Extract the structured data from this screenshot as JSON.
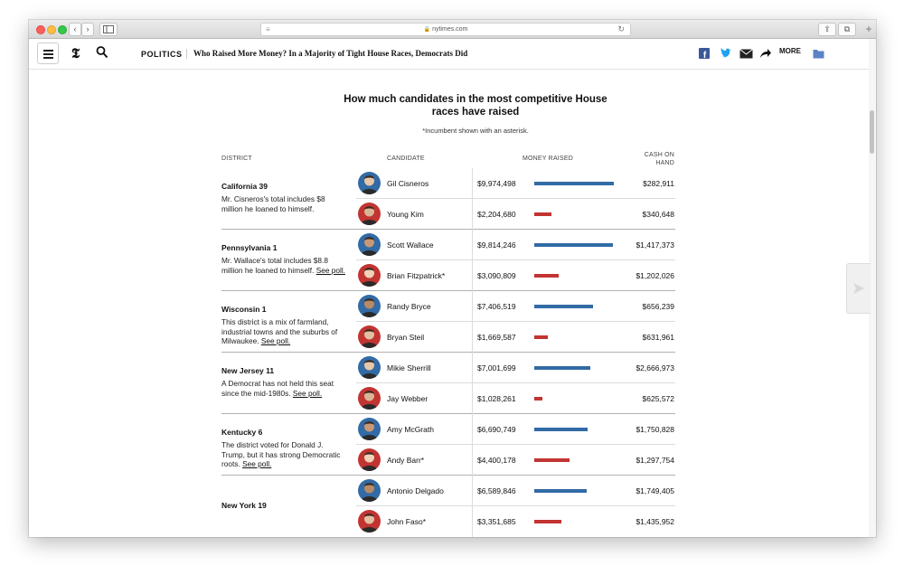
{
  "browser": {
    "url": "nytimes.com",
    "plus": "+"
  },
  "nav": {
    "section": "POLITICS",
    "headline": "Who Raised More Money? In a Majority of Tight House Races, Democrats Did",
    "more": "MORE"
  },
  "graphic": {
    "title": "How much candidates in the most competitive House races have raised",
    "note": "*Incumbent shown with an asterisk.",
    "columns": {
      "district": "DISTRICT",
      "candidate": "CANDIDATE",
      "money": "MONEY RAISED",
      "cash": "CASH ON HAND"
    },
    "max_money": 9974498,
    "colors": {
      "dem": "#326ba5",
      "rep": "#c23432"
    },
    "races": [
      {
        "district": "California 39",
        "desc": "Mr. Cisneros's total includes $8 million he loaned to himself.",
        "link": "",
        "candidates": [
          {
            "name": "Gil Cisneros",
            "money": "$9,974,498",
            "amount": 9974498,
            "cash": "$282,911",
            "party": "dem"
          },
          {
            "name": "Young Kim",
            "money": "$2,204,680",
            "amount": 2204680,
            "cash": "$340,648",
            "party": "rep"
          }
        ]
      },
      {
        "district": "Pennsylvania 1",
        "desc": "Mr. Wallace's total includes $8.8 million he loaned to himself. ",
        "link": "See poll.",
        "candidates": [
          {
            "name": "Scott Wallace",
            "money": "$9,814,246",
            "amount": 9814246,
            "cash": "$1,417,373",
            "party": "dem"
          },
          {
            "name": "Brian Fitzpatrick*",
            "money": "$3,090,809",
            "amount": 3090809,
            "cash": "$1,202,026",
            "party": "rep"
          }
        ]
      },
      {
        "district": "Wisconsin 1",
        "desc": "This district is a mix of farmland, industrial towns and the suburbs of Milwaukee. ",
        "link": "See poll.",
        "candidates": [
          {
            "name": "Randy Bryce",
            "money": "$7,406,519",
            "amount": 7406519,
            "cash": "$656,239",
            "party": "dem"
          },
          {
            "name": "Bryan Steil",
            "money": "$1,669,587",
            "amount": 1669587,
            "cash": "$631,961",
            "party": "rep"
          }
        ]
      },
      {
        "district": "New Jersey 11",
        "desc": "A Democrat has not held this seat since the mid-1980s. ",
        "link": "See poll.",
        "candidates": [
          {
            "name": "Mikie Sherrill",
            "money": "$7,001,699",
            "amount": 7001699,
            "cash": "$2,666,973",
            "party": "dem"
          },
          {
            "name": "Jay Webber",
            "money": "$1,028,261",
            "amount": 1028261,
            "cash": "$625,572",
            "party": "rep"
          }
        ]
      },
      {
        "district": "Kentucky 6",
        "desc": "The district voted for Donald J. Trump, but it has strong Democratic roots. ",
        "link": "See poll.",
        "candidates": [
          {
            "name": "Amy McGrath",
            "money": "$6,690,749",
            "amount": 6690749,
            "cash": "$1,750,828",
            "party": "dem"
          },
          {
            "name": "Andy Barr*",
            "money": "$4,400,178",
            "amount": 4400178,
            "cash": "$1,297,754",
            "party": "rep"
          }
        ]
      },
      {
        "district": "New York 19",
        "desc": "",
        "link": "",
        "candidates": [
          {
            "name": "Antonio Delgado",
            "money": "$6,589,846",
            "amount": 6589846,
            "cash": "$1,749,405",
            "party": "dem"
          },
          {
            "name": "John Faso*",
            "money": "$3,351,685",
            "amount": 3351685,
            "cash": "$1,435,952",
            "party": "rep"
          }
        ]
      }
    ]
  }
}
